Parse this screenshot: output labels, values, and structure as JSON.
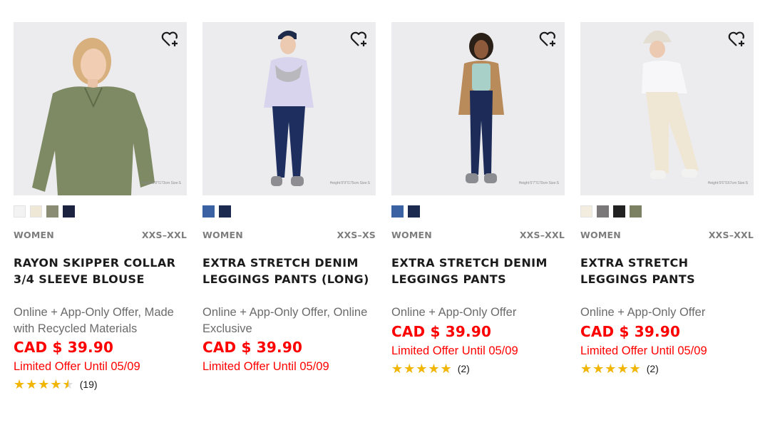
{
  "products": [
    {
      "category": "WOMEN",
      "sizes": "XXS–XXL",
      "name": "RAYON SKIPPER COLLAR 3/4 SLEEVE BLOUSE",
      "offer": "Online + App-Only Offer, Made with Recycled Materials",
      "price": "CAD $ 39.90",
      "limited": "Limited Offer Until 05/09",
      "rating": 4.5,
      "review_count": "(19)",
      "model_note": "Height:5'8\"/173cm Size:S",
      "swatches": [
        "#f3f3f3",
        "#efe8d6",
        "#8b8c74",
        "#1c2340"
      ]
    },
    {
      "category": "WOMEN",
      "sizes": "XXS–XS",
      "name": "EXTRA STRETCH DENIM LEGGINGS PANTS (LONG)",
      "offer": "Online + App-Only Offer, Online Exclusive",
      "price": "CAD $ 39.90",
      "limited": "Limited Offer Until 05/09",
      "rating": null,
      "review_count": "",
      "model_note": "Height:5'9\"/175cm Size:S",
      "swatches": [
        "#3b62a3",
        "#1b2a4e"
      ]
    },
    {
      "category": "WOMEN",
      "sizes": "XXS–XXL",
      "name": "EXTRA STRETCH DENIM LEGGINGS PANTS",
      "offer": "Online + App-Only Offer",
      "price": "CAD $ 39.90",
      "limited": "Limited Offer Until 05/09",
      "rating": 5,
      "review_count": "(2)",
      "model_note": "Height:5'7\"/170cm Size:S",
      "swatches": [
        "#3b62a3",
        "#1b2a4e"
      ]
    },
    {
      "category": "WOMEN",
      "sizes": "XXS–XXL",
      "name": "EXTRA STRETCH LEGGINGS PANTS",
      "offer": "Online + App-Only Offer",
      "price": "CAD $ 39.90",
      "limited": "Limited Offer Until 05/09",
      "rating": 5,
      "review_count": "(2)",
      "model_note": "Height:5'6\"/167cm Size:S",
      "swatches": [
        "#f3ede0",
        "#7a7879",
        "#222222",
        "#7c8164"
      ]
    }
  ],
  "icons": {
    "favorite": "heart-plus-icon",
    "star": "star-icon"
  },
  "colors": {
    "price_red": "#ff0000",
    "star_gold": "#f2b600",
    "muted_text": "#6b6b6b"
  }
}
